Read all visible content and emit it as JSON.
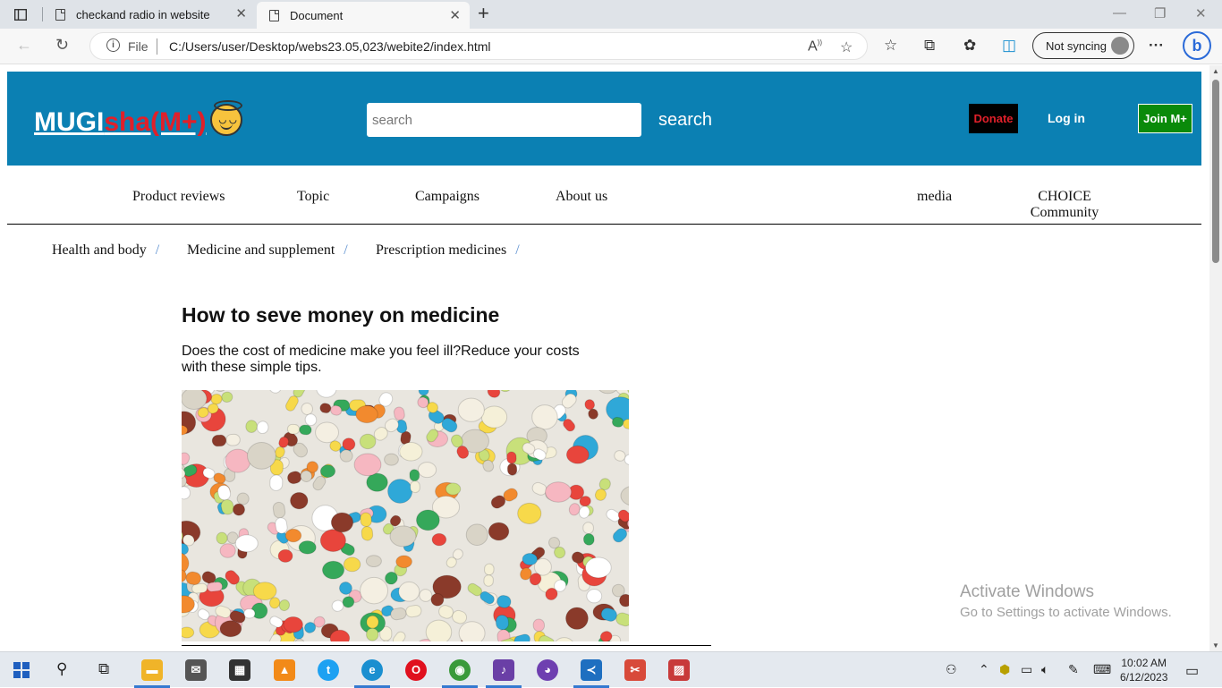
{
  "browser": {
    "tabs": [
      {
        "title": "checkand radio in website",
        "active": false
      },
      {
        "title": "Document",
        "active": true
      }
    ],
    "address": {
      "protocol_label": "File",
      "url": "C:/Users/user/Desktop/webs23.05,023/webite2/index.html"
    },
    "sync_label": "Not syncing"
  },
  "site": {
    "logo": {
      "part1": "MUGI",
      "part2": "sha(M+)"
    },
    "search": {
      "placeholder": "search",
      "button": "search"
    },
    "buttons": {
      "donate": "Donate",
      "login": "Log in",
      "join": "Join M+"
    },
    "colors": {
      "header_bg": "#0b80b3",
      "donate_bg": "#000000",
      "donate_text": "#e0202a",
      "join_bg": "#0a8a0a",
      "logo_accent": "#e0202a"
    },
    "nav": [
      {
        "label": "Product reviews"
      },
      {
        "label": "Topic"
      },
      {
        "label": "Campaigns"
      },
      {
        "label": "About us"
      },
      {
        "label": "media"
      },
      {
        "label": "CHOICE Community"
      }
    ],
    "breadcrumb": [
      {
        "label": "Health and body"
      },
      {
        "label": "Medicine and supplement"
      },
      {
        "label": "Prescription medicines"
      }
    ],
    "breadcrumb_sep": "/",
    "article": {
      "title": "How to seve money on medicine",
      "lead": "Does the cost of medicine make you feel ill?Reduce your costs with these simple tips."
    }
  },
  "watermark": {
    "line1": "Activate Windows",
    "line2": "Go to Settings to activate Windows."
  },
  "taskbar": {
    "time": "10:02 AM",
    "date": "6/12/2023"
  }
}
